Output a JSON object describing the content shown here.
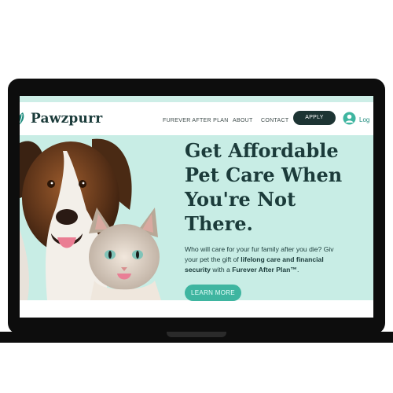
{
  "brand": {
    "name": "Pawzpurr"
  },
  "nav": {
    "links": [
      "FUREVER AFTER PLAN",
      "ABOUT",
      "CONTACT"
    ],
    "apply_label": "APPLY",
    "login_label": "Log"
  },
  "hero": {
    "title_lines": [
      "Get Affordable",
      "Pet Care When",
      "You're Not",
      "There."
    ],
    "body": {
      "line1": "Who will care for your fur family after you die? Giv",
      "line2_plain": "your pet the gift of ",
      "line2_bold": "lifelong care and financial",
      "line3_bold_a": "security",
      "line3_plain": " with a ",
      "line3_bold_b": "Furever After Plan™",
      "line3_end": "."
    },
    "cta_label": "LEARN MORE"
  },
  "colors": {
    "brand_dark": "#1b3b3a",
    "accent_teal": "#3fb5a0",
    "hero_background": "#c8ede5",
    "login_color": "#1f8c7e"
  },
  "icons": [
    "paw-leaf-logo-icon",
    "user-avatar-icon"
  ]
}
